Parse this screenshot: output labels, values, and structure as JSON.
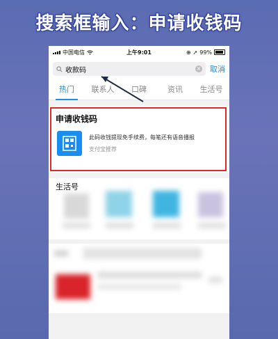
{
  "banner": {
    "text": "搜索框输入：申请收钱码"
  },
  "status_bar": {
    "carrier": "中国电信",
    "time": "上午9:01",
    "battery": "99%"
  },
  "search": {
    "query": "收款码",
    "cancel_label": "取消"
  },
  "tabs": [
    {
      "label": "热门",
      "active": true
    },
    {
      "label": "联系人",
      "active": false
    },
    {
      "label": "口碑",
      "active": false
    },
    {
      "label": "资讯",
      "active": false
    },
    {
      "label": "生活号",
      "active": false
    }
  ],
  "result": {
    "title": "申请收钱码",
    "description": "此码收钱提现免手续费，每笔还有语音播报",
    "source": "支付宝推荐"
  },
  "life_section": {
    "heading": "生活号"
  },
  "colors": {
    "accent": "#1a8ef0",
    "highlight": "#e02828",
    "banner_bg": "#5a6cb3"
  }
}
